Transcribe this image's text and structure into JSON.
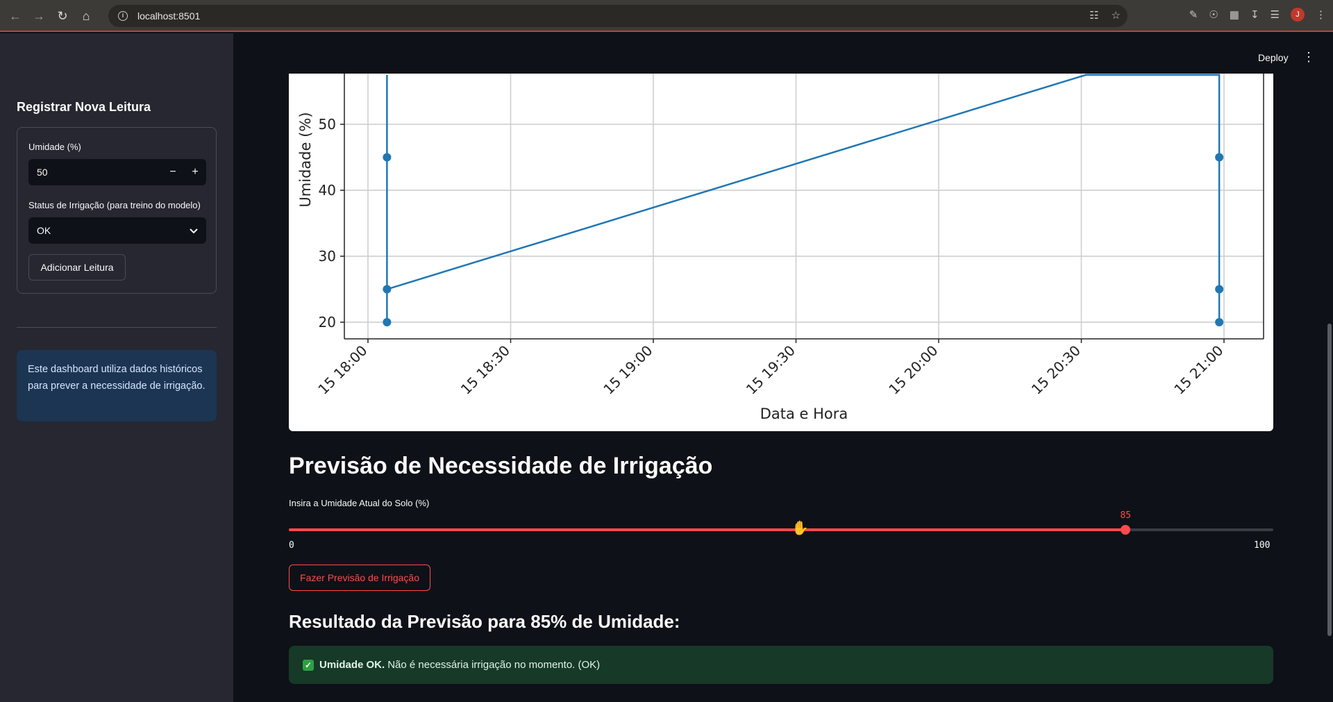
{
  "browser": {
    "url": "localhost:8501",
    "avatar_initial": "J"
  },
  "header": {
    "deploy_label": "Deploy"
  },
  "sidebar": {
    "title": "Registrar Nova Leitura",
    "humidity_label": "Umidade (%)",
    "humidity_value": "50",
    "status_label": "Status de Irrigação (para treino do modelo)",
    "status_value": "OK",
    "add_button": "Adicionar Leitura",
    "info_text": "Este dashboard utiliza dados históricos para prever a necessidade de irrigação."
  },
  "chart_data": {
    "type": "line",
    "xlabel": "Data e Hora",
    "ylabel": "Umidade (%)",
    "x_ticks": [
      "15 18:00",
      "15 18:30",
      "15 19:00",
      "15 19:30",
      "15 20:00",
      "15 20:30",
      "15 21:00"
    ],
    "y_ticks": [
      20,
      30,
      40,
      50
    ],
    "ylim": [
      17.5,
      57.5
    ],
    "grid": true,
    "series": [
      {
        "color": "#1f77b4",
        "points": [
          {
            "x": "15 18:04",
            "y": 57.5
          },
          {
            "x": "15 18:04",
            "y": 45
          },
          {
            "x": "15 18:04",
            "y": 20
          },
          {
            "x": "15 18:04",
            "y": 25
          },
          {
            "x": "15 20:31",
            "y": 57.5
          },
          {
            "x": "15 20:59",
            "y": 57.5
          },
          {
            "x": "15 20:59",
            "y": 45
          },
          {
            "x": "15 20:59",
            "y": 25
          },
          {
            "x": "15 20:59",
            "y": 20
          }
        ]
      }
    ]
  },
  "main": {
    "section_title": "Previsão de Necessidade de Irrigação",
    "slider_label": "Insira a Umidade Atual do Solo (%)",
    "slider_min": "0",
    "slider_max": "100",
    "slider_value": "85",
    "slider_fraction": 0.85,
    "predict_button": "Fazer Previsão de Irrigação",
    "result_title": "Resultado da Previsão para 85% de Umidade:",
    "result_bold": "Umidade OK.",
    "result_text": "Não é necessária irrigação no momento. (OK)"
  }
}
